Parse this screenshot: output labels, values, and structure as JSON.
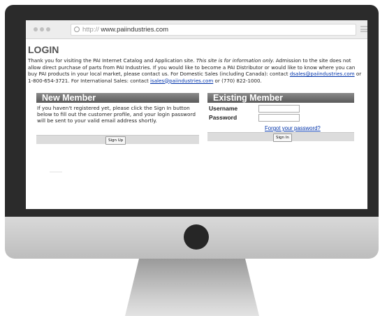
{
  "browser": {
    "url_protocol": "http://",
    "url_domain": "www.paiindustries.com"
  },
  "page": {
    "title": "LOGIN",
    "intro": {
      "p1": "Thank you for visiting the PAI Internet Catalog and Application site. ",
      "p1_italic": "This site is for information only.",
      "p2": " Admission to the site does not allow direct purchase of parts from PAI Industries. If you would like to become a PAI Distributor or would like to know where you can buy PAI products in your local market, please contact us. For Domestic Sales (including Canada): contact ",
      "domestic_email": "dsales@paiindustries.com",
      "p3": " or 1-800-654-3721. For International Sales: contact ",
      "intl_email": "isales@paiindustries.com",
      "p4": " or (770) 822-1000."
    }
  },
  "new_member": {
    "heading": "New Member",
    "text": "If you haven't registered yet, please click the Sign In button below to fill out the customer profile, and your login password will be sent to your valid email address shortly.",
    "button": "Sign Up"
  },
  "existing_member": {
    "heading": "Existing Member",
    "username_label": "Username",
    "password_label": "Password",
    "username_value": "",
    "password_value": "",
    "forgot_link": "Forgot your password?",
    "button": "Sign In"
  },
  "colors": {
    "monitor_bezel": "#2b2b2b",
    "link": "#0033aa",
    "panel_header": "#6e6e6e"
  }
}
